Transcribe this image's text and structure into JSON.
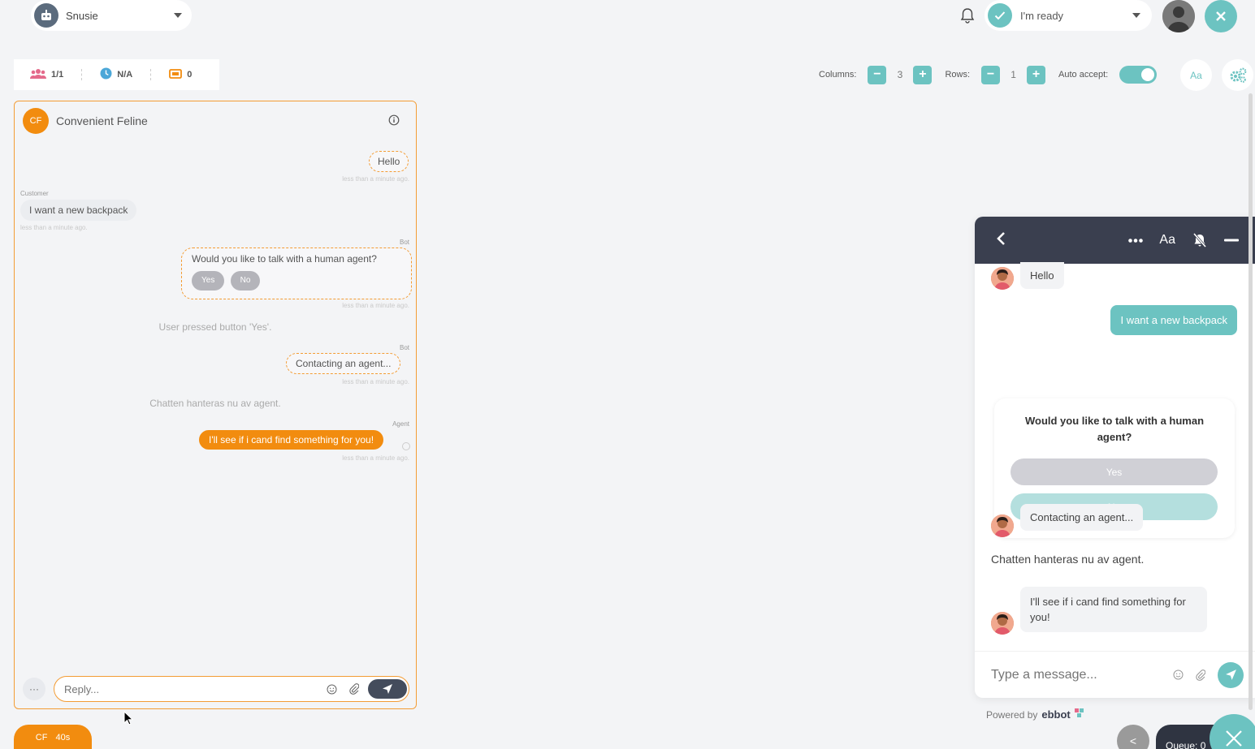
{
  "topbar": {
    "bot_name": "Snusie",
    "status_label": "I'm ready"
  },
  "stats": {
    "agents": "1/1",
    "wait_time": "N/A",
    "tickets": "0"
  },
  "controls": {
    "columns_label": "Columns:",
    "columns_value": "3",
    "rows_label": "Rows:",
    "rows_value": "1",
    "auto_accept_label": "Auto accept:",
    "auto_accept_on": true,
    "font_button": "Aa"
  },
  "chat": {
    "initials": "CF",
    "title": "Convenient Feline",
    "messages": {
      "hello": "Hello",
      "hello_time": "less than a minute ago.",
      "customer_label": "Customer",
      "customer_msg": "I want a new backpack",
      "customer_time": "less than a minute ago.",
      "bot_label_1": "Bot",
      "bot_question": "Would you like to talk with a human agent?",
      "yes": "Yes",
      "no": "No",
      "bot_time_1": "less than a minute ago.",
      "user_pressed": "User pressed button 'Yes'.",
      "bot_label_2": "Bot",
      "contacting": "Contacting an agent...",
      "bot_time_2": "less than a minute ago.",
      "handled": "Chatten hanteras nu av agent.",
      "agent_label": "Agent",
      "agent_msg": "I'll see if i cand find something for you!",
      "agent_time": "less than a minute ago."
    },
    "reply_placeholder": "Reply...",
    "more_label": "···"
  },
  "tab_chip": {
    "initials": "CF",
    "time": "40s"
  },
  "widget": {
    "font_label": "Aa",
    "hello": "Hello",
    "user_msg": "I want a new backpack",
    "card_title": "Would you like to talk with a human agent?",
    "yes": "Yes",
    "no": "No",
    "contacting": "Contacting an agent...",
    "handled": "Chatten hanteras nu av agent.",
    "agent_msg": "I'll see if i cand find something for you!",
    "input_placeholder": "Type a message..."
  },
  "footer": {
    "powered_by": "Powered by",
    "brand": "ebbot",
    "queue": "Queue: 0",
    "prev": "<"
  },
  "colors": {
    "teal": "#6cc3c1",
    "orange": "#f28c0f",
    "dark": "#3a3f4f"
  }
}
